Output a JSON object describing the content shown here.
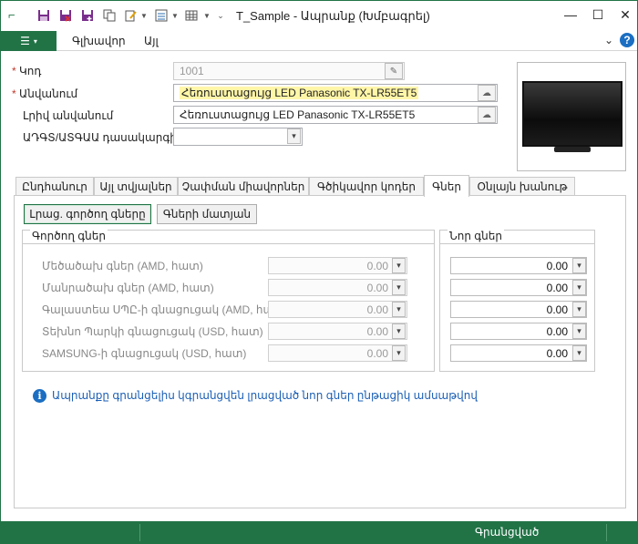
{
  "window": {
    "title": "T_Sample - Ապրանք (Խմբագրել)"
  },
  "quick_access": {
    "icons": [
      "app-logo-icon",
      "save-icon",
      "save-close-icon",
      "save-new-icon",
      "copy-icon",
      "edit-icon",
      "options-icon",
      "table-icon",
      "dropdown-icon"
    ]
  },
  "ribbon": {
    "file_label": "☰",
    "tabs": [
      "Գլխավոր",
      "Այլ"
    ]
  },
  "form": {
    "code_label": "Կոդ",
    "code_value": "1001",
    "name_label": "Անվանում",
    "name_value": "Հեռուստացույց LED Panasonic TX-LR55ET5",
    "fullname_label": "Լրիվ անվանում",
    "fullname_value": "Հեռուստացույց LED Panasonic TX-LR55ET5",
    "classifier_label": "ԱԴԳՏ/ԱՏԳԱԱ դասակարգիչ",
    "classifier_value": ""
  },
  "tabs": {
    "items": [
      "Ընդհանուր",
      "Այլ տվյալներ",
      "Չափման միավորներ",
      "Գծիկավոր կոդեր",
      "Գներ",
      "Օնլայն խանութ"
    ],
    "active_index": 4
  },
  "prices": {
    "fill_button": "Լրաց. գործող գները",
    "history_button": "Գների մատյան",
    "current_title": "Գործող գներ",
    "new_title": "Նոր գներ",
    "rows": [
      {
        "label": "Մեծածախ գներ (AMD, հատ)",
        "current": "0.00",
        "new": "0.00"
      },
      {
        "label": "Մանրածախ գներ (AMD, հատ)",
        "current": "0.00",
        "new": "0.00"
      },
      {
        "label": "Գալաստեա ՍՊԸ-ի գնացուցակ (AMD, հատ)",
        "current": "0.00",
        "new": "0.00"
      },
      {
        "label": "Տեխնո Պարկի գնացուցակ (USD, հատ)",
        "current": "0.00",
        "new": "0.00"
      },
      {
        "label": "SAMSUNG-ի գնացուցակ (USD, հատ)",
        "current": "0.00",
        "new": "0.00"
      }
    ],
    "info_text": "Ապրանքը գրանցելիս կգրանցվեն լրացված նոր գներ ընթացիկ ամսաթվով"
  },
  "status": {
    "text": "Գրանցված"
  },
  "colors": {
    "accent": "#217346",
    "required": "#c0392b",
    "info": "#1b6ec2",
    "highlight": "#fff6a8"
  }
}
